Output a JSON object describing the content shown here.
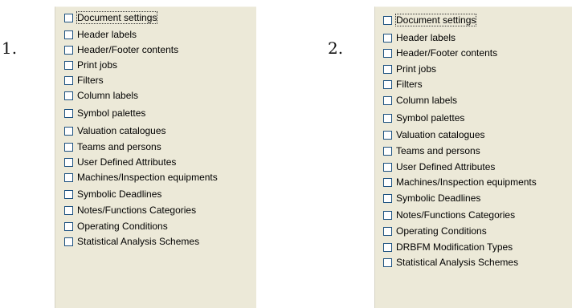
{
  "figure_labels": [
    "1.",
    "2."
  ],
  "panels": [
    {
      "items": [
        {
          "label": "Document settings",
          "checked": false,
          "focused": true
        },
        {
          "label": "Header labels",
          "checked": false
        },
        {
          "label": "Header/Footer contents",
          "checked": false
        },
        {
          "label": "Print jobs",
          "checked": false
        },
        {
          "label": "Filters",
          "checked": false
        },
        {
          "label": "Column labels",
          "checked": false
        },
        {
          "label": "Symbol palettes",
          "checked": false
        },
        {
          "label": "Valuation catalogues",
          "checked": false
        },
        {
          "label": "Teams and persons",
          "checked": false
        },
        {
          "label": "User Defined Attributes",
          "checked": false
        },
        {
          "label": "Machines/Inspection equipments",
          "checked": false
        },
        {
          "label": "Symbolic Deadlines",
          "checked": false
        },
        {
          "label": "Notes/Functions Categories",
          "checked": false
        },
        {
          "label": "Operating Conditions",
          "checked": false
        },
        {
          "label": "Statistical Analysis Schemes",
          "checked": false
        }
      ]
    },
    {
      "items": [
        {
          "label": "Document settings",
          "checked": false,
          "focused": true
        },
        {
          "label": "Header labels",
          "checked": false
        },
        {
          "label": "Header/Footer contents",
          "checked": false
        },
        {
          "label": "Print jobs",
          "checked": false
        },
        {
          "label": "Filters",
          "checked": false
        },
        {
          "label": "Column labels",
          "checked": false
        },
        {
          "label": "Symbol palettes",
          "checked": false
        },
        {
          "label": "Valuation catalogues",
          "checked": false
        },
        {
          "label": "Teams and persons",
          "checked": false
        },
        {
          "label": "User Defined Attributes",
          "checked": false
        },
        {
          "label": "Machines/Inspection equipments",
          "checked": false
        },
        {
          "label": "Symbolic Deadlines",
          "checked": false
        },
        {
          "label": "Notes/Functions Categories",
          "checked": false
        },
        {
          "label": "Operating Conditions",
          "checked": false
        },
        {
          "label": "DRBFM Modification Types",
          "checked": false
        },
        {
          "label": "Statistical Analysis Schemes",
          "checked": false
        }
      ]
    }
  ]
}
